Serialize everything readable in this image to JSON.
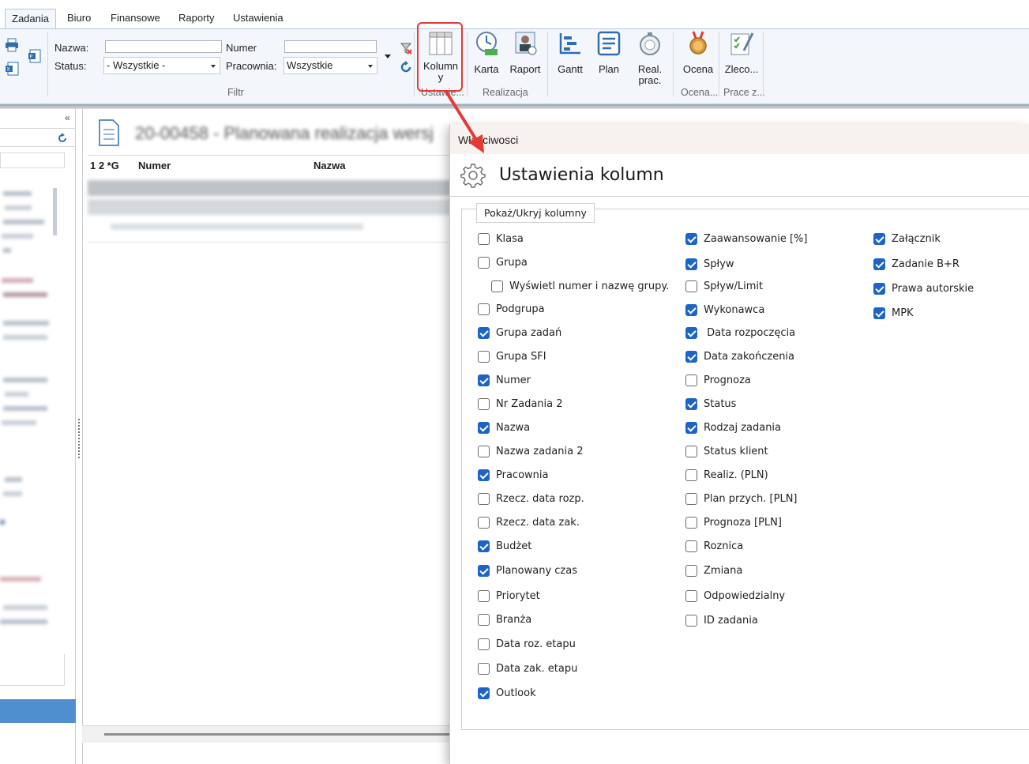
{
  "tabs": [
    "Zadania",
    "Biuro",
    "Finansowe",
    "Raporty",
    "Ustawienia"
  ],
  "filter": {
    "nazwa_label": "Nazwa:",
    "status_label": "Status:",
    "status_value": "- Wszystkie -",
    "numer_label": "Numer",
    "pracownia_label": "Pracownia:",
    "pracownia_value": "Wszystkie",
    "group_label": "Filtr"
  },
  "ribbon_buttons": {
    "kolumny": "Kolumn y",
    "karta": "Karta",
    "raport": "Raport",
    "gantt": "Gantt",
    "plan": "Plan",
    "real_prac": "Real. prac.",
    "ocena": "Ocena",
    "zlecenia": "Zleco..."
  },
  "ribbon_groups": {
    "ustawienia": "Ustawie...",
    "realizacja": "Realizacja",
    "ocena": "Ocena...",
    "prace": "Prace z..."
  },
  "document": {
    "title": "20-00458 - Planowana realizacja wersj",
    "columns": [
      "1 2 *G",
      "Numer",
      "Nazwa"
    ]
  },
  "dialog": {
    "window_title": "Właściwosci",
    "heading": "Ustawienia kolumn",
    "group_title": "Pokaż/Ukryj kolumny",
    "col1": [
      {
        "label": "Klasa",
        "checked": false
      },
      {
        "label": "Grupa",
        "checked": false
      },
      {
        "label": "Wyświetl numer i nazwę grupy.",
        "checked": false
      },
      {
        "label": "Podgrupa",
        "checked": false
      },
      {
        "label": "Grupa zadań",
        "checked": true
      },
      {
        "label": "Grupa SFI",
        "checked": false
      },
      {
        "label": "Numer",
        "checked": true
      },
      {
        "label": "Nr Zadania 2",
        "checked": false
      },
      {
        "label": "Nazwa",
        "checked": true
      },
      {
        "label": "Nazwa zadania 2",
        "checked": false
      },
      {
        "label": "Pracownia",
        "checked": true
      },
      {
        "label": "Rzecz. data rozp.",
        "checked": false
      },
      {
        "label": "Rzecz. data zak.",
        "checked": false
      },
      {
        "label": "Budżet",
        "checked": true
      },
      {
        "label": "Planowany czas",
        "checked": true
      },
      {
        "label": "Priorytet",
        "checked": false
      },
      {
        "label": "Branża",
        "checked": false
      },
      {
        "label": "Data roz. etapu",
        "checked": false
      },
      {
        "label": "Data zak. etapu",
        "checked": false
      },
      {
        "label": "Outlook",
        "checked": true
      }
    ],
    "col2": [
      {
        "label": "Zaawansowanie [%]",
        "checked": true
      },
      {
        "label": "Spływ",
        "checked": true
      },
      {
        "label": "Spływ/Limit",
        "checked": false
      },
      {
        "label": "Wykonawca",
        "checked": true
      },
      {
        "label": " Data rozpoczęcia",
        "checked": true
      },
      {
        "label": "Data zakończenia",
        "checked": true
      },
      {
        "label": "Prognoza",
        "checked": false
      },
      {
        "label": "Status",
        "checked": true
      },
      {
        "label": "Rodzaj zadania",
        "checked": true
      },
      {
        "label": "Status klient",
        "checked": false
      },
      {
        "label": "Realiz. (PLN)",
        "checked": false
      },
      {
        "label": "Plan przych. [PLN]",
        "checked": false
      },
      {
        "label": "Prognoza [PLN]",
        "checked": false
      },
      {
        "label": "Roznica",
        "checked": false
      },
      {
        "label": "Zmiana",
        "checked": false
      },
      {
        "label": "Odpowiedzialny",
        "checked": false
      },
      {
        "label": "ID zadania",
        "checked": false
      }
    ],
    "col3": [
      {
        "label": "Załącznik",
        "checked": true
      },
      {
        "label": "Zadanie B+R",
        "checked": true
      },
      {
        "label": "Prawa autorskie",
        "checked": true
      },
      {
        "label": "MPK",
        "checked": true
      }
    ]
  },
  "colors": {
    "accent": "#1d64c8",
    "highlight": "#e53935",
    "ribbon_bg": "#f3f6fb"
  }
}
